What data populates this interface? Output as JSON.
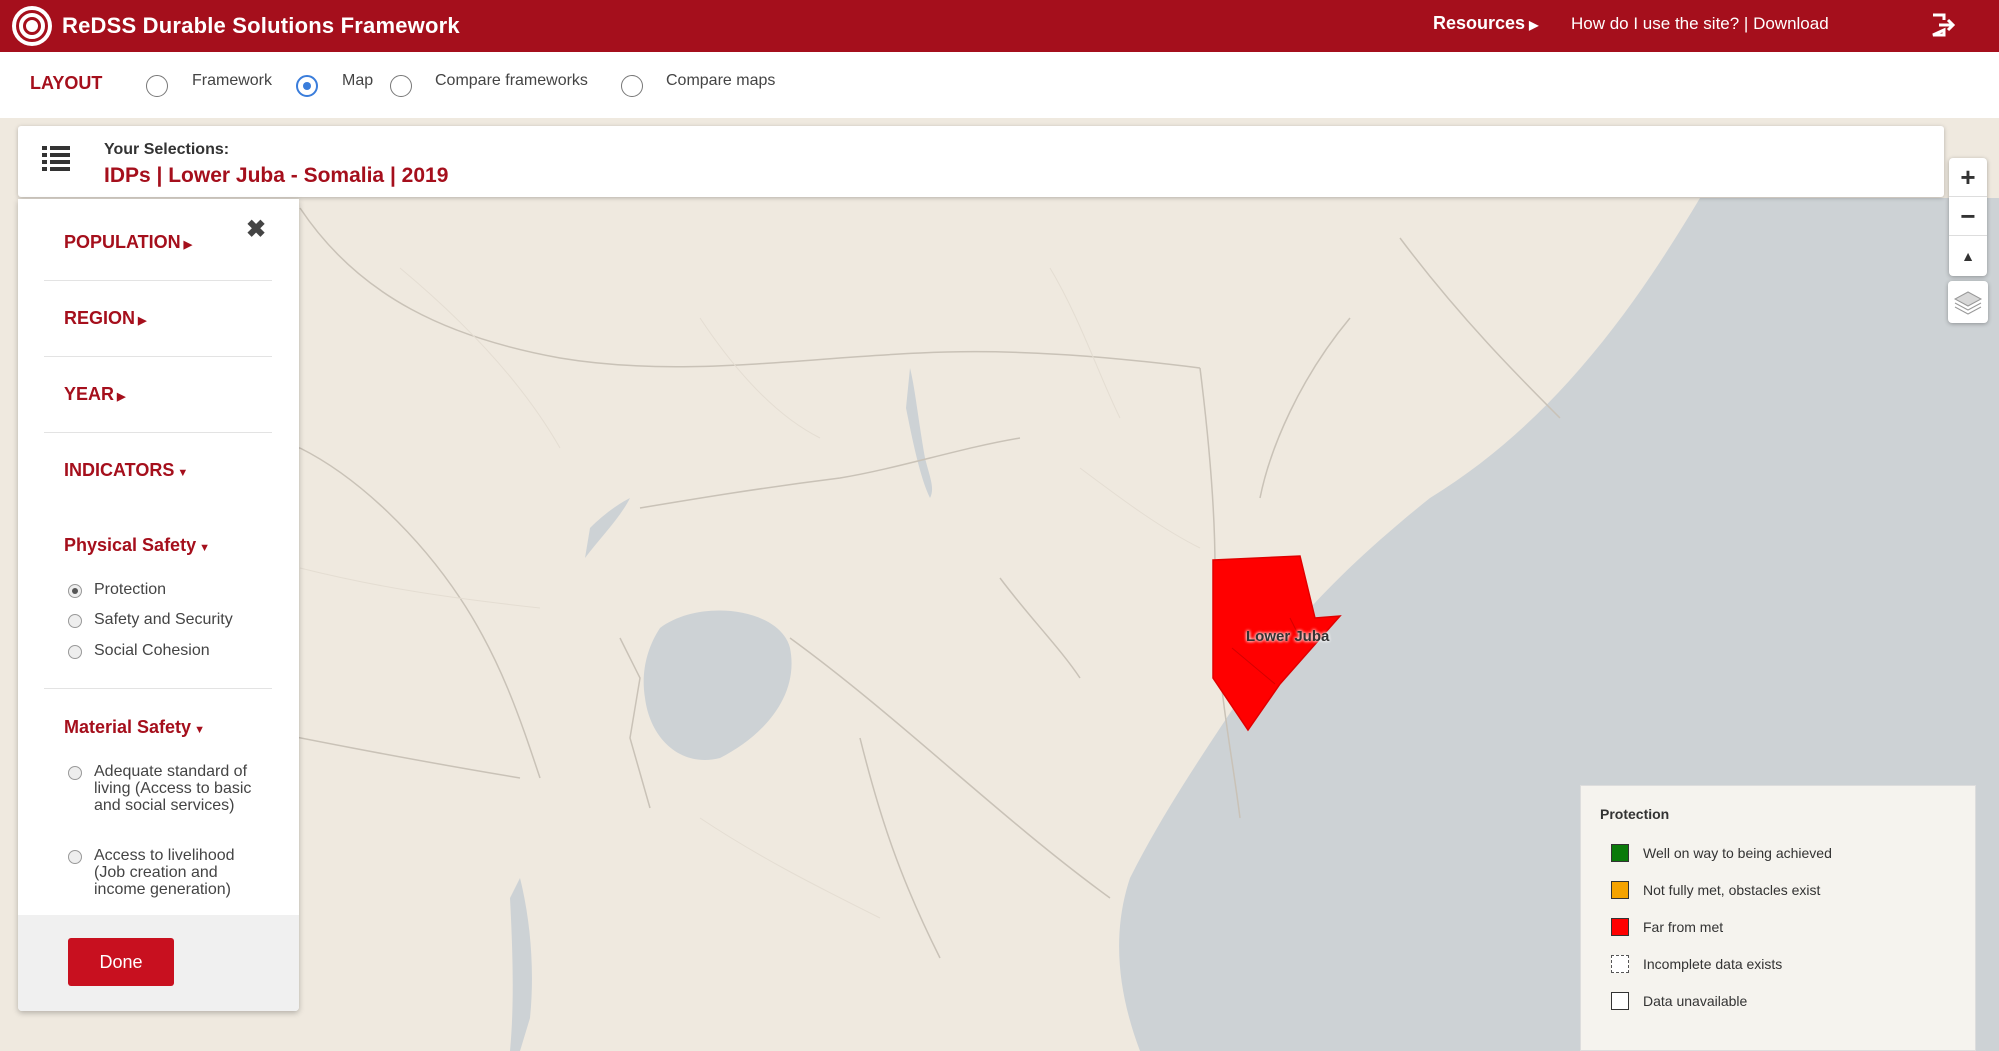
{
  "header": {
    "app_title": "ReDSS Durable Solutions Framework",
    "resources_label": "Resources",
    "help_links": "How do I use the site? | Download"
  },
  "layout": {
    "label": "LAYOUT",
    "options": [
      "Framework",
      "Map",
      "Compare frameworks",
      "Compare maps"
    ],
    "selected": "Map"
  },
  "selections": {
    "label": "Your Selections:",
    "value": "IDPs | Lower Juba - Somalia | 2019"
  },
  "panel": {
    "sections": [
      "POPULATION",
      "REGION",
      "YEAR",
      "INDICATORS"
    ],
    "physical_safety": {
      "label": "Physical Safety",
      "options": [
        "Protection",
        "Safety and Security",
        "Social Cohesion"
      ],
      "selected": "Protection"
    },
    "material_safety": {
      "label": "Material Safety",
      "options": [
        "Adequate standard of living (Access to basic and social services)",
        "Access to livelihood (Job creation and income generation)"
      ]
    },
    "done_label": "Done"
  },
  "map": {
    "region_label": "Lower Juba",
    "region_color": "#ff0000",
    "land_color": "#efe9df",
    "water_color": "#cdd2d5"
  },
  "legend": {
    "title": "Protection",
    "items": [
      {
        "label": "Well on way to being achieved",
        "color": "#0a7a0a"
      },
      {
        "label": "Not fully met, obstacles exist",
        "color": "#f5a300"
      },
      {
        "label": "Far from met",
        "color": "#ff0000"
      },
      {
        "label": "Incomplete data exists",
        "color": "#ffffff"
      },
      {
        "label": "Data unavailable",
        "color": "#ffffff"
      }
    ]
  },
  "icons": [
    "logo-icon",
    "logout-icon",
    "menu-list-icon",
    "close-icon",
    "zoom-in-icon",
    "zoom-out-icon",
    "compass-icon",
    "layers-icon"
  ]
}
